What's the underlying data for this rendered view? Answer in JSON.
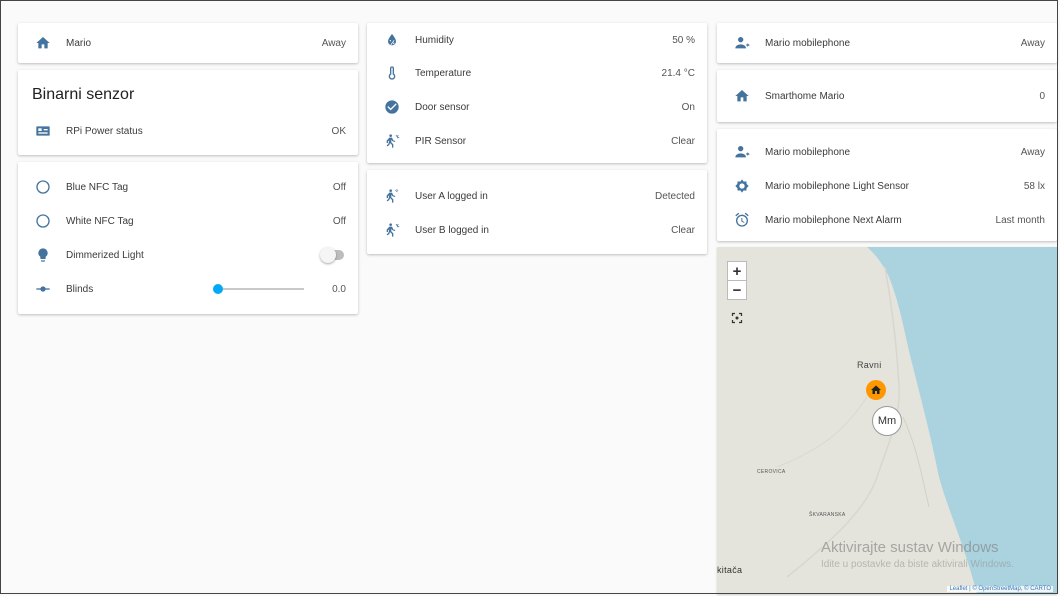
{
  "col1": {
    "card1": {
      "rows": [
        {
          "label": "Mario",
          "value": "Away",
          "icon": "home-icon"
        }
      ]
    },
    "card2": {
      "title": "Binarni senzor",
      "rows": [
        {
          "label": "RPi Power status",
          "value": "OK",
          "icon": "raspberry-pi-icon"
        }
      ]
    },
    "card3": {
      "rows": [
        {
          "label": "Blue NFC Tag",
          "value": "Off",
          "icon": "circle-outline-icon"
        },
        {
          "label": "White NFC Tag",
          "value": "Off",
          "icon": "circle-outline-icon"
        },
        {
          "label": "Dimmerized Light",
          "value": "",
          "icon": "lightbulb-icon",
          "toggle_on": false
        },
        {
          "label": "Blinds",
          "value": "0.0",
          "icon": "slider-icon",
          "slider_fraction": 0.0
        }
      ]
    }
  },
  "col2": {
    "card1": {
      "rows": [
        {
          "label": "Humidity",
          "value": "50 %",
          "icon": "water-percent-icon"
        },
        {
          "label": "Temperature",
          "value": "21.4 °C",
          "icon": "thermometer-icon"
        },
        {
          "label": "Door sensor",
          "value": "On",
          "icon": "check-circle-icon"
        },
        {
          "label": "PIR Sensor",
          "value": "Clear",
          "icon": "motion-sensor-icon"
        }
      ]
    },
    "card2": {
      "rows": [
        {
          "label": "User A logged in",
          "value": "Detected",
          "icon": "walk-icon"
        },
        {
          "label": "User B logged in",
          "value": "Clear",
          "icon": "motion-sensor-icon"
        }
      ]
    }
  },
  "col3": {
    "card1": {
      "rows": [
        {
          "label": "Mario mobilephone",
          "value": "Away",
          "icon": "account-arrow-icon"
        }
      ]
    },
    "card2": {
      "rows": [
        {
          "label": "Smarthome Mario",
          "value": "0",
          "icon": "home-icon"
        }
      ]
    },
    "card3": {
      "rows": [
        {
          "label": "Mario mobilephone",
          "value": "Away",
          "icon": "account-arrow-icon"
        },
        {
          "label": "Mario mobilephone Light Sensor",
          "value": "58 lx",
          "icon": "brightness-icon"
        },
        {
          "label": "Mario mobilephone Next Alarm",
          "value": "Last month",
          "icon": "alarm-icon"
        }
      ]
    }
  },
  "map": {
    "zoom_in": "+",
    "zoom_out": "−",
    "labels": {
      "ravni": "Ravni",
      "cerovica": "CEROVICA",
      "skvaranska": "ŠKVARANSKA",
      "kitaca": "kitača"
    },
    "marker_person": "Mm",
    "watermark_title": "Aktivirajte sustav Windows",
    "watermark_sub": "Idite u postavke da biste aktivirali Windows.",
    "attribution": "Leaflet | © OpenStreetMap, © CARTO",
    "colors": {
      "sea": "#aad3df",
      "land": "#e4e4dc",
      "home_marker": "#ff9800"
    }
  },
  "colors": {
    "icon": "#44739e",
    "accent": "#03a9f4"
  }
}
